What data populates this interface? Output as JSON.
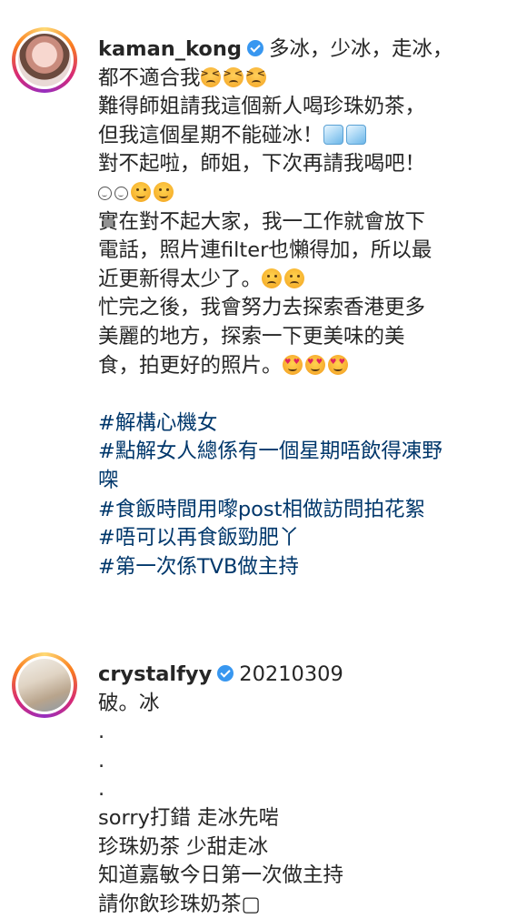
{
  "posts": [
    {
      "username": "kaman_kong",
      "verified": true,
      "caption": {
        "l1_text": "多冰，少冰，走冰，",
        "l2_text": "都不適合我",
        "l2_emojis": [
          "persevering-face",
          "persevering-face",
          "persevering-face"
        ],
        "l3_text": "難得師姐請我這個新人喝珍珠奶茶，",
        "l4_text": "但我這個星期不能碰冰！",
        "l4_emojis": [
          "ice-cube",
          "ice-cube"
        ],
        "l5_text": "對不起啦，師姐，下次再請我喝吧！",
        "l6_emojis": [
          "smiling-face",
          "smiling-face",
          "winking-face",
          "winking-face"
        ],
        "l7_text": "實在對不起大家，我一工作就會放下",
        "l8_text": "電話，照片連filter也懶得加，所以最",
        "l9_text": "近更新得太少了。",
        "l9_emojis": [
          "frowning-face",
          "frowning-face"
        ],
        "l10_text": "忙完之後，我會努力去探索香港更多",
        "l11_text": "美麗的地方，探索一下更美味的美",
        "l12_text": "食，拍更好的照片。",
        "l12_emojis": [
          "smiling-face-with-hearts",
          "smiling-face-with-hearts",
          "smiling-face-with-hearts"
        ]
      },
      "hashtags": {
        "h1": "#解構心機女",
        "h2a": "#點解女人總係有一個星期唔飲得凍野",
        "h2b": "㗎",
        "h3": "#食飯時間用嚟post相做訪問拍花絮",
        "h4": "#唔可以再食飯勁肥丫",
        "h5": "#第一次係TVB做主持"
      }
    },
    {
      "username": "crystalfyy",
      "verified": true,
      "date": "20210309",
      "lines": {
        "l1": "破。冰",
        "l2": ".",
        "l3": ".",
        "l4": ".",
        "l5": "sorry打錯 走冰先啱",
        "l6": "珍珠奶茶 少甜走冰",
        "l7": "知道嘉敏今日第一次做主持",
        "l8": "請你飲珍珠奶茶▢"
      }
    }
  ],
  "colors": {
    "text": "#262626",
    "hashtag": "#00376b",
    "verified": "#3897f0"
  }
}
